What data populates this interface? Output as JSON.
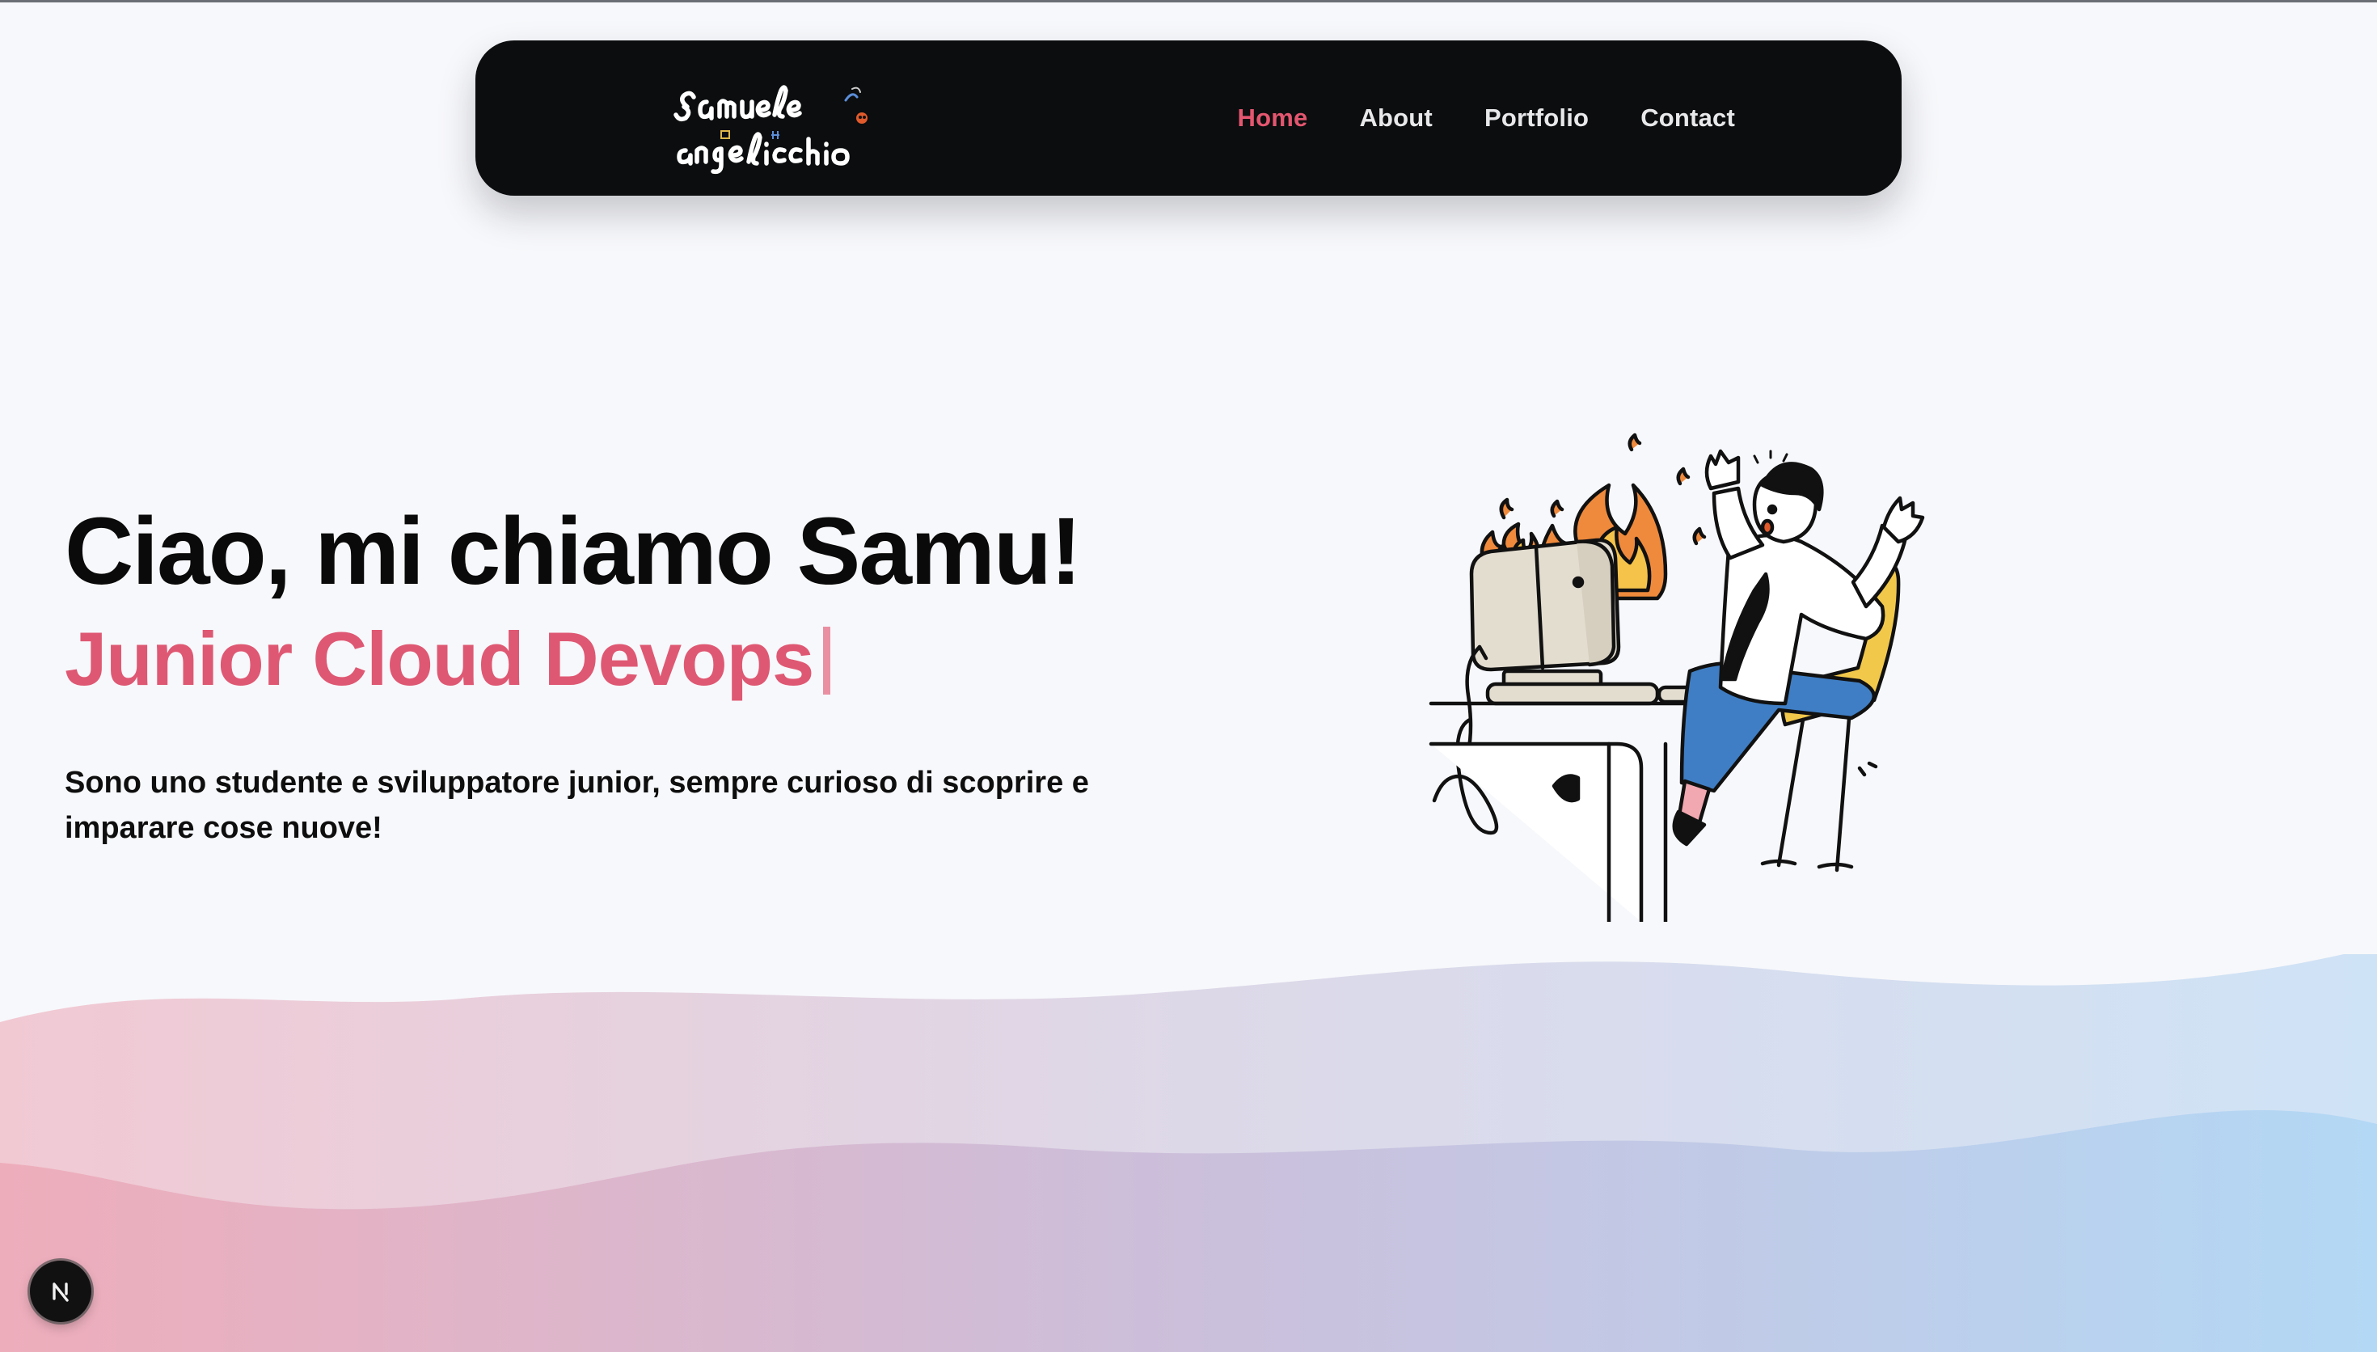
{
  "nav": {
    "logo_text": "samuele angelicchio",
    "links": [
      {
        "label": "Home",
        "active": true
      },
      {
        "label": "About",
        "active": false
      },
      {
        "label": "Portfolio",
        "active": false
      },
      {
        "label": "Contact",
        "active": false
      }
    ]
  },
  "hero": {
    "title": "Ciao, mi chiamo Samu!",
    "subtitle": "Junior Cloud Devops",
    "description": "Sono uno studente e sviluppatore junior, sempre curioso di scoprire e imparare cose nuove!"
  },
  "illustration": {
    "icon": "developer-with-burning-computer-illustration"
  },
  "badge": {
    "icon": "nextjs-icon",
    "glyph": "N"
  },
  "colors": {
    "accent": "#e4566f",
    "navbar_bg": "#0b0d0e",
    "page_bg": "#f7f8fb",
    "wave_pink": "#eeacbb",
    "wave_blue": "#b3d8f5"
  }
}
